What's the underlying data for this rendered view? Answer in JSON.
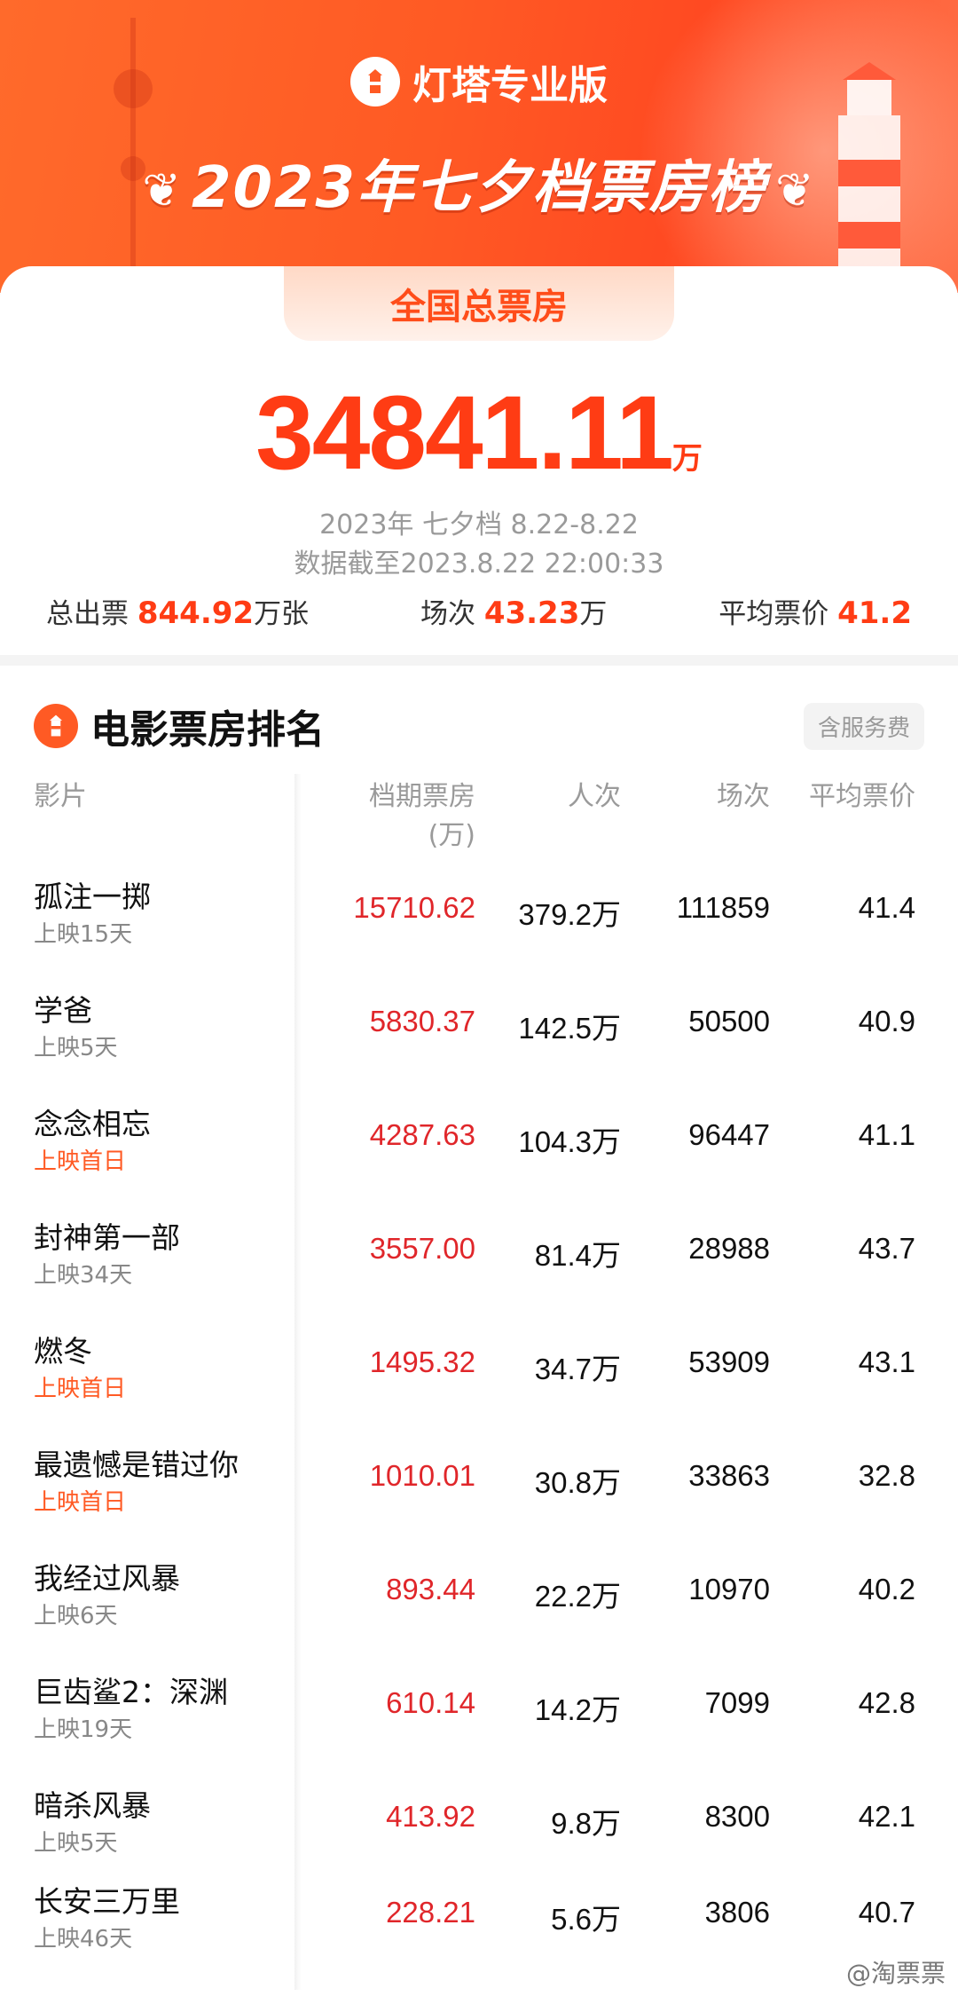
{
  "header": {
    "brand": "灯塔专业版",
    "title": "2023年七夕档票房榜"
  },
  "summary": {
    "tab_label": "全国总票房",
    "total_value": "34841.11",
    "total_unit": "万",
    "period": "2023年 七夕档 8.22-8.22",
    "as_of": "数据截至2023.8.22 22:00:33",
    "tickets_label": "总出票",
    "tickets_value": "844.92",
    "tickets_unit": "万张",
    "shows_label": "场次",
    "shows_value": "43.23",
    "shows_unit": "万",
    "avg_label": "平均票价",
    "avg_value": "41.2"
  },
  "ranking": {
    "title": "电影票房排名",
    "fee_badge": "含服务费",
    "columns": {
      "film": "影片",
      "box_office": "档期票房",
      "box_office_unit": "(万)",
      "audience": "人次",
      "shows": "场次",
      "avg_price": "平均票价"
    },
    "rows": [
      {
        "name": "孤注一掷",
        "days": "上映15天",
        "box": "15710.62",
        "audience": "379.2万",
        "shows": "111859",
        "avg": "41.4"
      },
      {
        "name": "学爸",
        "days": "上映5天",
        "box": "5830.37",
        "audience": "142.5万",
        "shows": "50500",
        "avg": "40.9"
      },
      {
        "name": "念念相忘",
        "days": "上映首日",
        "box": "4287.63",
        "audience": "104.3万",
        "shows": "96447",
        "avg": "41.1"
      },
      {
        "name": "封神第一部",
        "days": "上映34天",
        "box": "3557.00",
        "audience": "81.4万",
        "shows": "28988",
        "avg": "43.7"
      },
      {
        "name": "燃冬",
        "days": "上映首日",
        "box": "1495.32",
        "audience": "34.7万",
        "shows": "53909",
        "avg": "43.1"
      },
      {
        "name": "最遗憾是错过你",
        "days": "上映首日",
        "box": "1010.01",
        "audience": "30.8万",
        "shows": "33863",
        "avg": "32.8"
      },
      {
        "name": "我经过风暴",
        "days": "上映6天",
        "box": "893.44",
        "audience": "22.2万",
        "shows": "10970",
        "avg": "40.2"
      },
      {
        "name": "巨齿鲨2：深渊",
        "days": "上映19天",
        "box": "610.14",
        "audience": "14.2万",
        "shows": "7099",
        "avg": "42.8"
      },
      {
        "name": "暗杀风暴",
        "days": "上映5天",
        "box": "413.92",
        "audience": "9.8万",
        "shows": "8300",
        "avg": "42.1"
      },
      {
        "name": "长安三万里",
        "days": "上映46天",
        "box": "228.21",
        "audience": "5.6万",
        "shows": "3806",
        "avg": "40.7"
      }
    ]
  },
  "watermark": "@淘票票",
  "colors": {
    "accent": "#ff3c14",
    "box_office": "#e0262a",
    "hot_days": "#ff5a24"
  }
}
